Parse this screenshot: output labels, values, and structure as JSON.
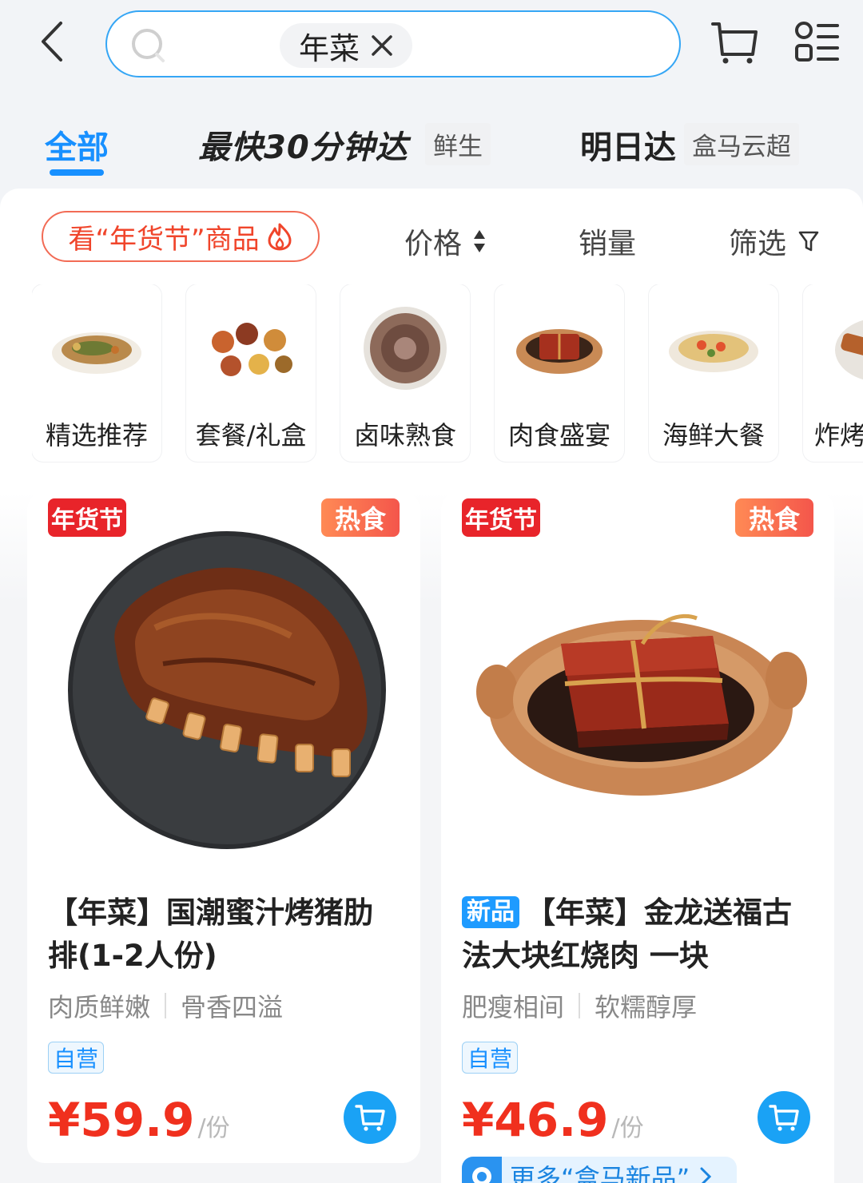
{
  "header": {
    "search_chip": "年菜",
    "icons": [
      "back-icon",
      "search-icon",
      "close-icon",
      "cart-icon",
      "menu-icon"
    ]
  },
  "tabs": {
    "all": "全部",
    "fast": "最快30分钟达",
    "fast_tag": "鲜生",
    "tomorrow": "明日达",
    "tomorrow_tag": "盒马云超"
  },
  "filter_bar": {
    "promo": "看“年货节”商品",
    "price": "价格",
    "sales": "销量",
    "filter": "筛选"
  },
  "categories": [
    {
      "label": "精选推荐"
    },
    {
      "label": "套餐/礼盒"
    },
    {
      "label": "卤味熟食"
    },
    {
      "label": "肉食盛宴"
    },
    {
      "label": "海鲜大餐"
    },
    {
      "label": "炸烤"
    }
  ],
  "products": [
    {
      "badge_left": "年货节",
      "badge_right": "热食",
      "title": "【年菜】国潮蜜汁烤猪肋排(1-2人份)",
      "feature_1": "肉质鲜嫩",
      "feature_2": "骨香四溢",
      "tag": "自营",
      "price": "¥59.9",
      "unit": "/份"
    },
    {
      "badge_left": "年货节",
      "badge_right": "热食",
      "new_badge": "新品",
      "title": "【年菜】金龙送福古法大块红烧肉 一块",
      "feature_1": "肥瘦相间",
      "feature_2": "软糯醇厚",
      "tag": "自营",
      "price": "¥46.9",
      "unit": "/份",
      "more_link": "更多“盒马新品”"
    }
  ],
  "colors": {
    "accent_blue": "#1890ff",
    "price_red": "#f0301e",
    "festival_red": "#e8242a",
    "hot_orange": "#ff8a55"
  }
}
